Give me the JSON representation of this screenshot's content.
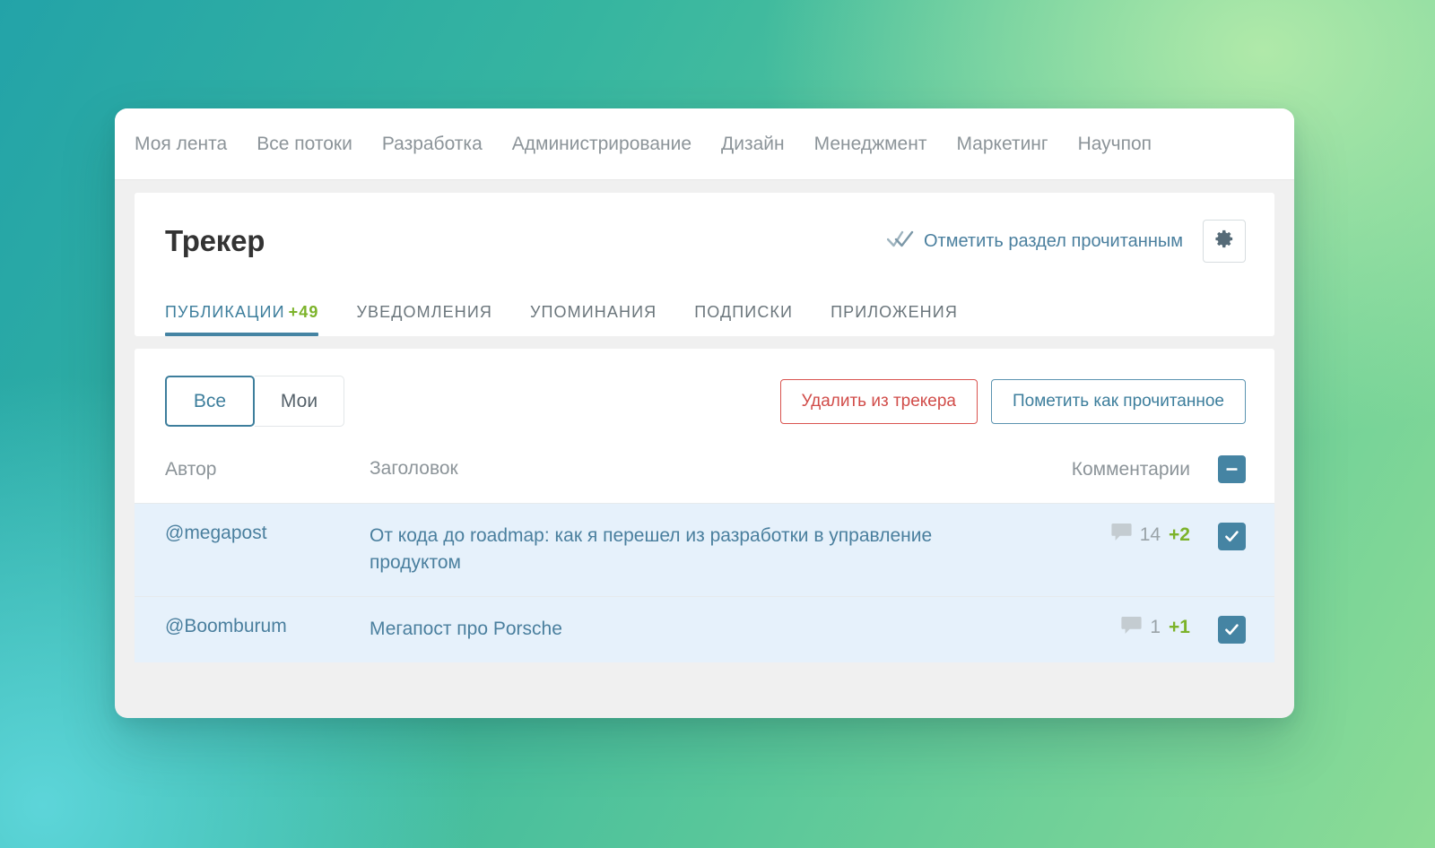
{
  "topnav": {
    "items": [
      {
        "label": "Моя лента"
      },
      {
        "label": "Все потоки"
      },
      {
        "label": "Разработка"
      },
      {
        "label": "Администрирование"
      },
      {
        "label": "Дизайн"
      },
      {
        "label": "Менеджмент"
      },
      {
        "label": "Маркетинг"
      },
      {
        "label": "Научпоп"
      }
    ]
  },
  "header": {
    "title": "Трекер",
    "mark_read_label": "Отметить раздел прочитанным",
    "mark_read_icon": "double-check-icon",
    "settings_icon": "gear-icon"
  },
  "tabs": [
    {
      "label": "ПУБЛИКАЦИИ",
      "badge": "+49",
      "active": true
    },
    {
      "label": "УВЕДОМЛЕНИЯ",
      "badge": "",
      "active": false
    },
    {
      "label": "УПОМИНАНИЯ",
      "badge": "",
      "active": false
    },
    {
      "label": "ПОДПИСКИ",
      "badge": "",
      "active": false
    },
    {
      "label": "ПРИЛОЖЕНИЯ",
      "badge": "",
      "active": false
    }
  ],
  "toolbar": {
    "filter_all": "Все",
    "filter_mine": "Мои",
    "filter_selected": "Все",
    "delete_label": "Удалить из трекера",
    "mark_read_label": "Пометить как прочитанное"
  },
  "table": {
    "columns": {
      "author": "Автор",
      "title": "Заголовок",
      "comments": "Комментарии"
    },
    "select_all_state": "indeterminate",
    "select_all_icon": "minus-icon",
    "rows": [
      {
        "author": "@megapost",
        "title": "От кода до roadmap: как я перешел из разработки в управление продуктом",
        "comments_count": "14",
        "comments_new": "+2",
        "comments_icon": "comment-bubble-icon",
        "checked": true,
        "check_icon": "check-icon"
      },
      {
        "author": "@Boomburum",
        "title": "Мегапост про Porsche",
        "comments_count": "1",
        "comments_new": "+1",
        "comments_icon": "comment-bubble-icon",
        "checked": true,
        "check_icon": "check-icon"
      }
    ]
  },
  "colors": {
    "accent_teal": "#4584a3",
    "link_blue": "#4a7f9e",
    "badge_green": "#7cb32a",
    "danger_red": "#d9534f",
    "row_highlight": "#e6f1fb",
    "muted_gray": "#8c9499"
  }
}
